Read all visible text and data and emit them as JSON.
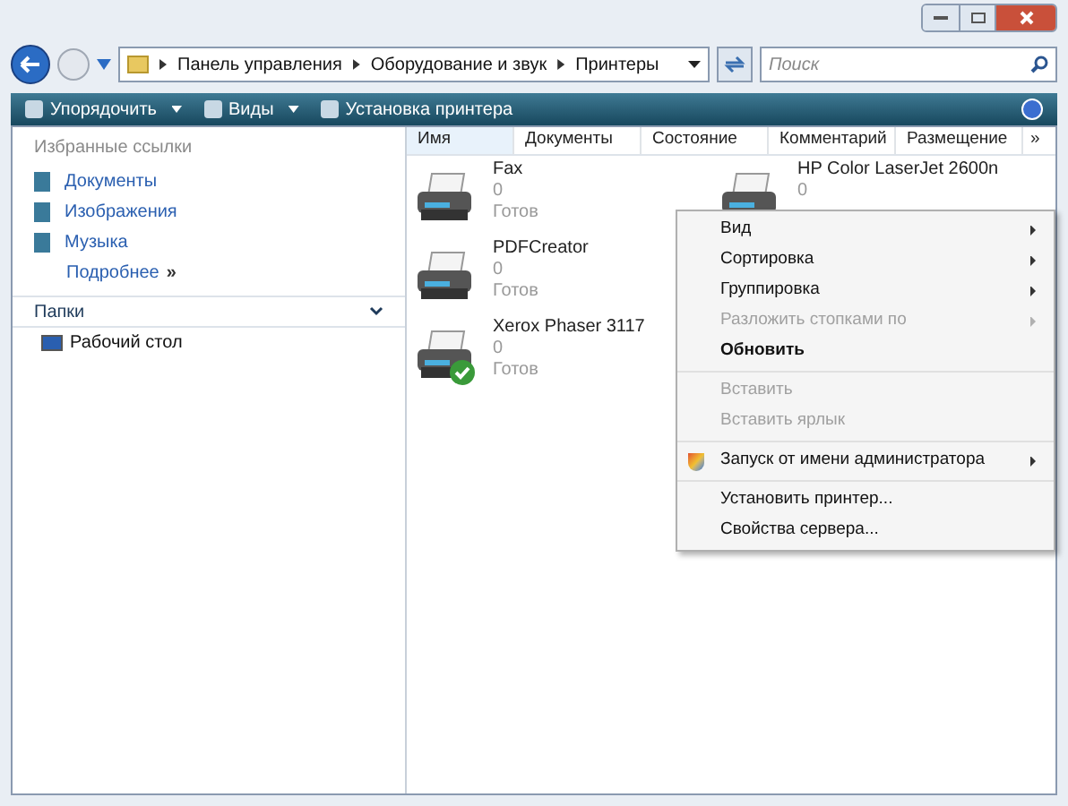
{
  "address": {
    "crumbs": [
      "Панель управления",
      "Оборудование и звук",
      "Принтеры"
    ]
  },
  "search": {
    "placeholder": "Поиск"
  },
  "toolbar": [
    "Упорядочить",
    "Виды",
    "Установка принтера"
  ],
  "sidebar": {
    "favorites_title": "Избранные ссылки",
    "links": [
      {
        "label": "Документы"
      },
      {
        "label": "Изображения"
      },
      {
        "label": "Музыка"
      }
    ],
    "more": "Подробнее",
    "more_glyph": "»",
    "folders_title": "Папки",
    "folders_expanded": true,
    "folders": [
      {
        "label": "Рабочий стол"
      }
    ]
  },
  "table": {
    "columns": [
      "Имя",
      "Документы",
      "Состояние",
      "Комментарий",
      "Размещение"
    ],
    "more_glyph": "»"
  },
  "printers": [
    {
      "name": "Fax",
      "jobs": "0",
      "status": "Готов",
      "default": false
    },
    {
      "name": "PDFCreator",
      "jobs": "0",
      "status": "Готов",
      "default": false
    },
    {
      "name": "Xerox Phaser 3117",
      "jobs": "0",
      "status": "Готов",
      "default": true
    },
    {
      "name": "HP Color LaserJet 2600n",
      "jobs": "0",
      "default": false
    }
  ],
  "context_menu": [
    [
      {
        "label": "Вид",
        "submenu": true,
        "disabled": false,
        "bold": false
      },
      {
        "label": "Сортировка",
        "submenu": true,
        "disabled": false,
        "bold": false
      },
      {
        "label": "Группировка",
        "submenu": true,
        "disabled": false,
        "bold": false
      },
      {
        "label": "Разложить стопками по",
        "submenu": true,
        "disabled": true,
        "bold": false
      },
      {
        "label": "Обновить",
        "submenu": false,
        "disabled": false,
        "bold": true
      }
    ],
    [
      {
        "label": "Вставить",
        "submenu": false,
        "disabled": true,
        "bold": false
      },
      {
        "label": "Вставить ярлык",
        "submenu": false,
        "disabled": true,
        "bold": false
      }
    ],
    [
      {
        "label": "Запуск от имени администратора",
        "submenu": true,
        "disabled": false,
        "bold": false,
        "shield": true
      }
    ],
    [
      {
        "label": "Установить принтер...",
        "submenu": false,
        "disabled": false,
        "bold": false
      },
      {
        "label": "Свойства сервера...",
        "submenu": false,
        "disabled": false,
        "bold": false
      }
    ]
  ]
}
